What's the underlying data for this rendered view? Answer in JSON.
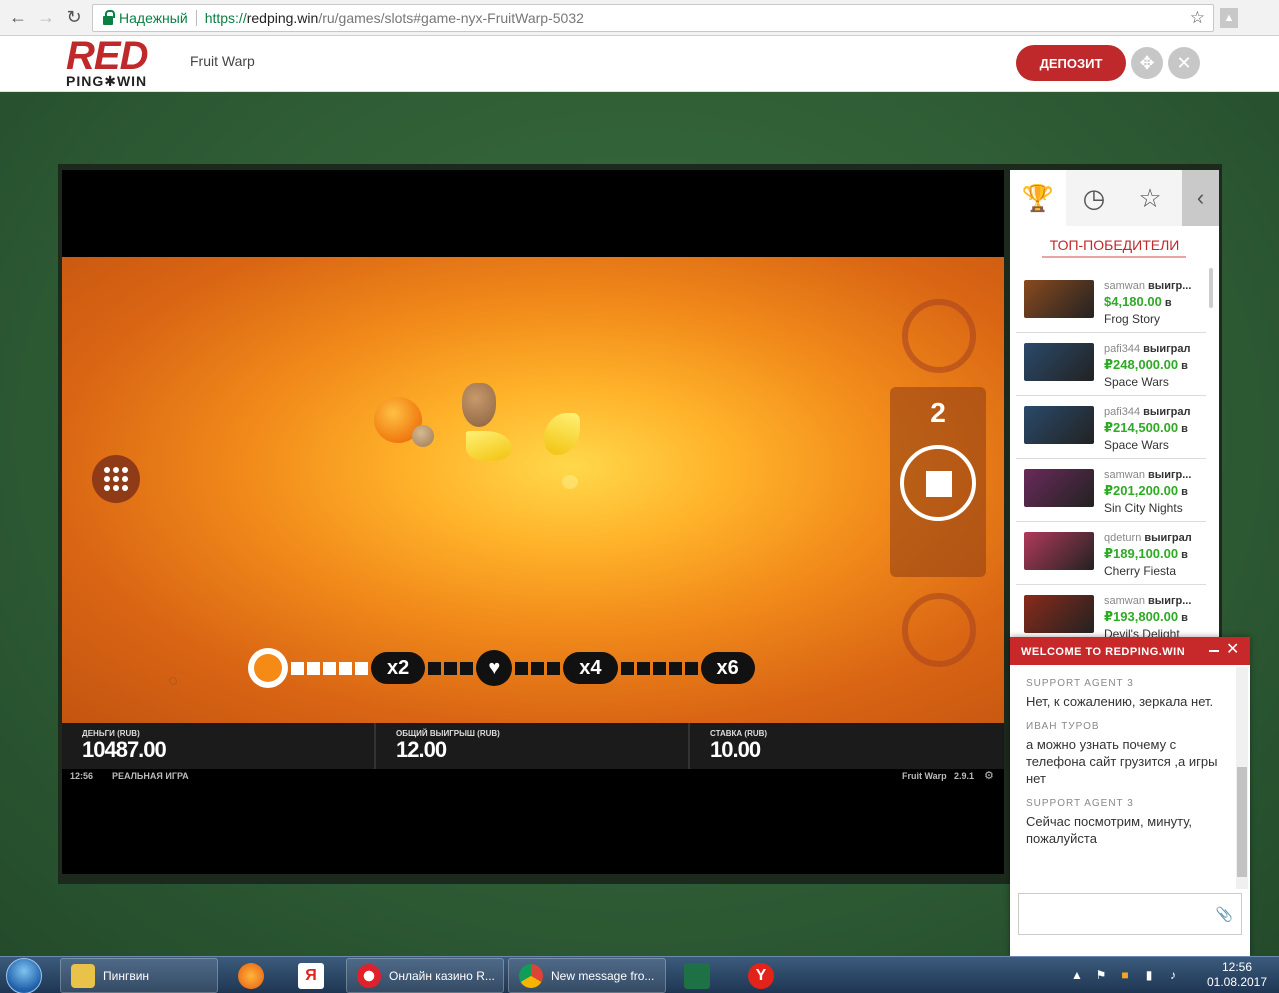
{
  "browser": {
    "secure_label": "Надежный",
    "url_proto": "https://",
    "url_host": "redping.win",
    "url_path": "/ru/games/slots#game-nyx-FruitWarp-5032"
  },
  "header": {
    "logo_red": "RED",
    "logo_pingwin": "PING✱WIN",
    "game_title": "Fruit Warp",
    "deposit_label": "ДЕПОЗИТ"
  },
  "game": {
    "spin_count": "2",
    "multipliers": [
      "x2",
      "x4",
      "x6"
    ],
    "balance_label": "ДЕНЬГИ (RUB)",
    "balance_value": "10487.00",
    "total_win_label": "ОБЩИЙ ВЫИГРЫШ (RUB)",
    "total_win_value": "12.00",
    "bet_label": "СТАВКА (RUB)",
    "bet_value": "10.00",
    "time": "12:56",
    "mode": "РЕАЛЬНАЯ ИГРА",
    "game_name": "Fruit Warp",
    "version": "2.9.1"
  },
  "sidebar": {
    "title": "ТОП-ПОБЕДИТЕЛИ",
    "winners": [
      {
        "user": "samwan",
        "action": "выигр...",
        "amount": "$4,180.00",
        "in": "в",
        "game": "Frog Story",
        "color": "#8a4a1e"
      },
      {
        "user": "pafi344",
        "action": "выиграл",
        "amount": "₽248,000.00",
        "in": "в",
        "game": "Space Wars",
        "color": "#2a4a6a"
      },
      {
        "user": "pafi344",
        "action": "выиграл",
        "amount": "₽214,500.00",
        "in": "в",
        "game": "Space Wars",
        "color": "#2a4a6a"
      },
      {
        "user": "samwan",
        "action": "выигр...",
        "amount": "₽201,200.00",
        "in": "в",
        "game": "Sin City Nights",
        "color": "#6a2a5a"
      },
      {
        "user": "qdeturn",
        "action": "выиграл",
        "amount": "₽189,100.00",
        "in": "в",
        "game": "Cherry Fiesta",
        "color": "#b03a5a"
      },
      {
        "user": "samwan",
        "action": "выигр...",
        "amount": "₽193,800.00",
        "in": "в",
        "game": "Devil's Delight",
        "color": "#8a2a1a"
      }
    ]
  },
  "chat": {
    "title": "WELCOME TO REDPING.WIN",
    "messages": [
      {
        "author": "SUPPORT AGENT 3",
        "text": "Нет, к сожалению, зеркала нет."
      },
      {
        "author": "ИВАН ТУРОВ",
        "text": "а можно узнать почему с телефона сайт грузится ,а игры нет"
      },
      {
        "author": "SUPPORT AGENT 3",
        "text": "Сейчас посмотрим, минуту, пожалуйста"
      }
    ]
  },
  "taskbar": {
    "explorer_label": "Пингвин",
    "opera_label": "Онлайн казино R...",
    "chrome_label": "New message fro...",
    "time": "12:56",
    "date": "01.08.2017"
  }
}
